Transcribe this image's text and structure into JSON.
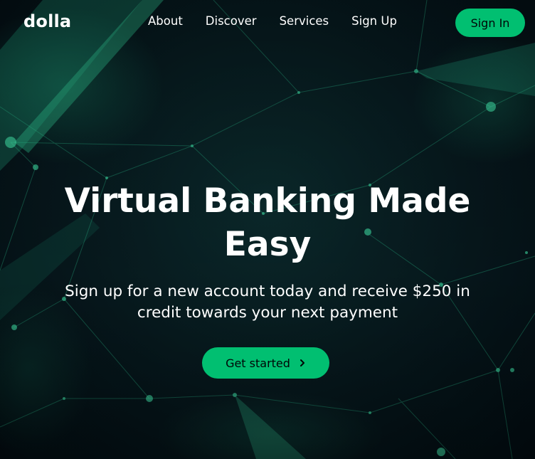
{
  "navbar": {
    "logo": "dolla",
    "items": [
      {
        "label": "About"
      },
      {
        "label": "Discover"
      },
      {
        "label": "Services"
      },
      {
        "label": "Sign Up"
      }
    ],
    "signin_label": "Sign In"
  },
  "hero": {
    "title": "Virtual Banking Made Easy",
    "subtitle": "Sign up for a new account today and receive $250 in credit towards your next payment",
    "cta_label": "Get started",
    "cta_icon": "chevron-right-icon",
    "background": "network-lines-background"
  },
  "colors": {
    "accent": "#01bf71",
    "background": "#06171c",
    "text": "#ffffff",
    "button_text": "#010606"
  }
}
